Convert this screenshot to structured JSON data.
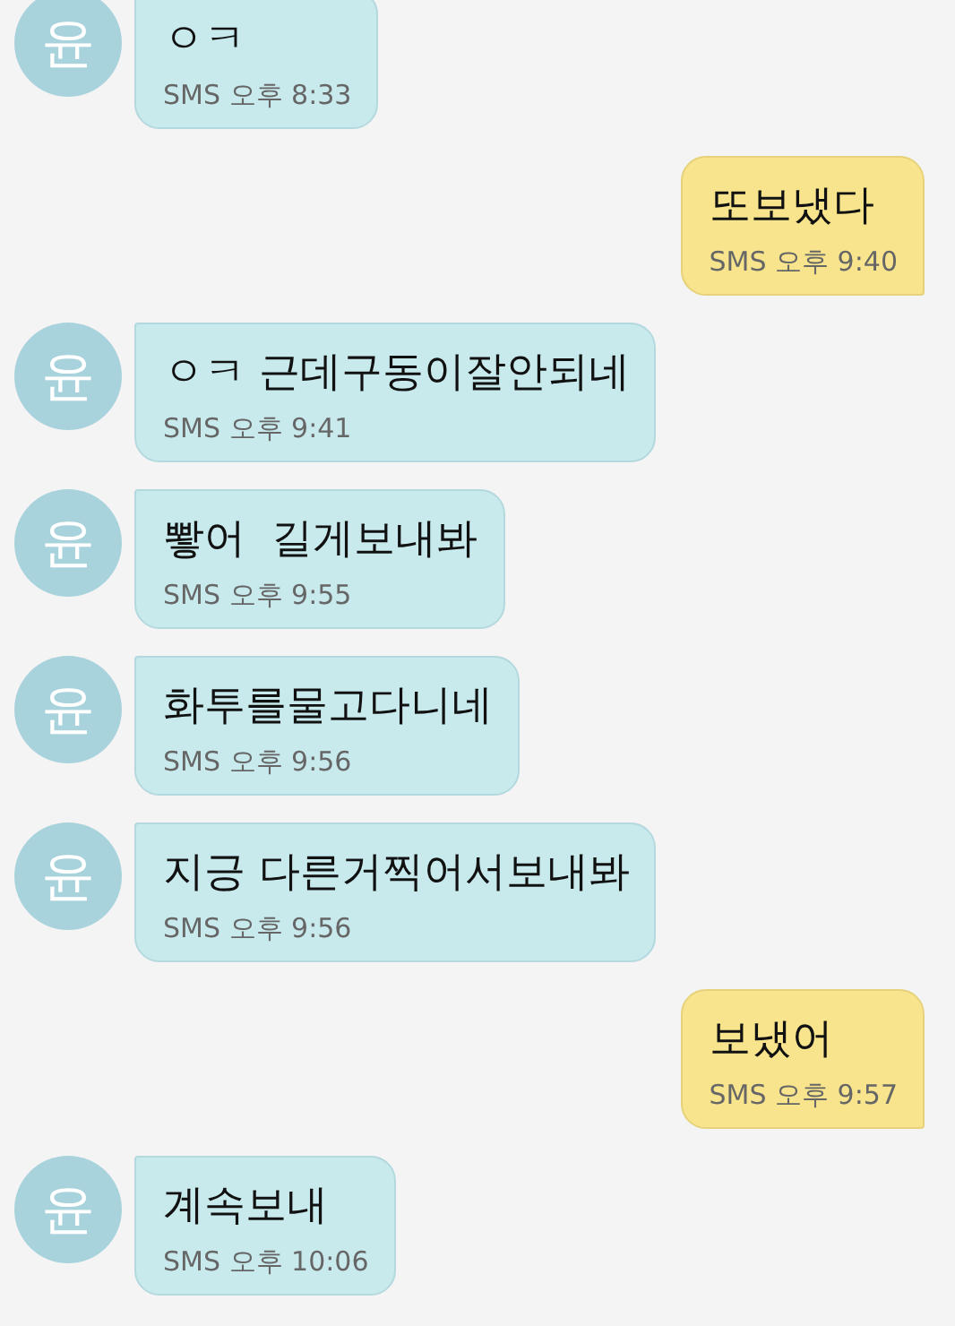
{
  "messages": [
    {
      "kind": "incoming",
      "avatar": "윤",
      "text": "ㅇㅋ",
      "meta": "SMS 오후 8:33"
    },
    {
      "kind": "outgoing",
      "text": "또보냈다",
      "meta": "SMS 오후 9:40"
    },
    {
      "kind": "incoming",
      "avatar": "윤",
      "text": "ㅇㅋ 근데구동이잘안되네",
      "meta": "SMS 오후 9:41"
    },
    {
      "kind": "incoming",
      "avatar": "윤",
      "text": "뽷어  길게보내봐",
      "meta": "SMS 오후 9:55"
    },
    {
      "kind": "incoming",
      "avatar": "윤",
      "text": "화투를물고다니네",
      "meta": "SMS 오후 9:56"
    },
    {
      "kind": "incoming",
      "avatar": "윤",
      "text": "지긍 다른거찍어서보내봐",
      "meta": "SMS 오후 9:56"
    },
    {
      "kind": "outgoing",
      "text": "보냈어",
      "meta": "SMS 오후 9:57"
    },
    {
      "kind": "incoming",
      "avatar": "윤",
      "text": "계속보내",
      "meta": "SMS 오후 10:06"
    }
  ]
}
